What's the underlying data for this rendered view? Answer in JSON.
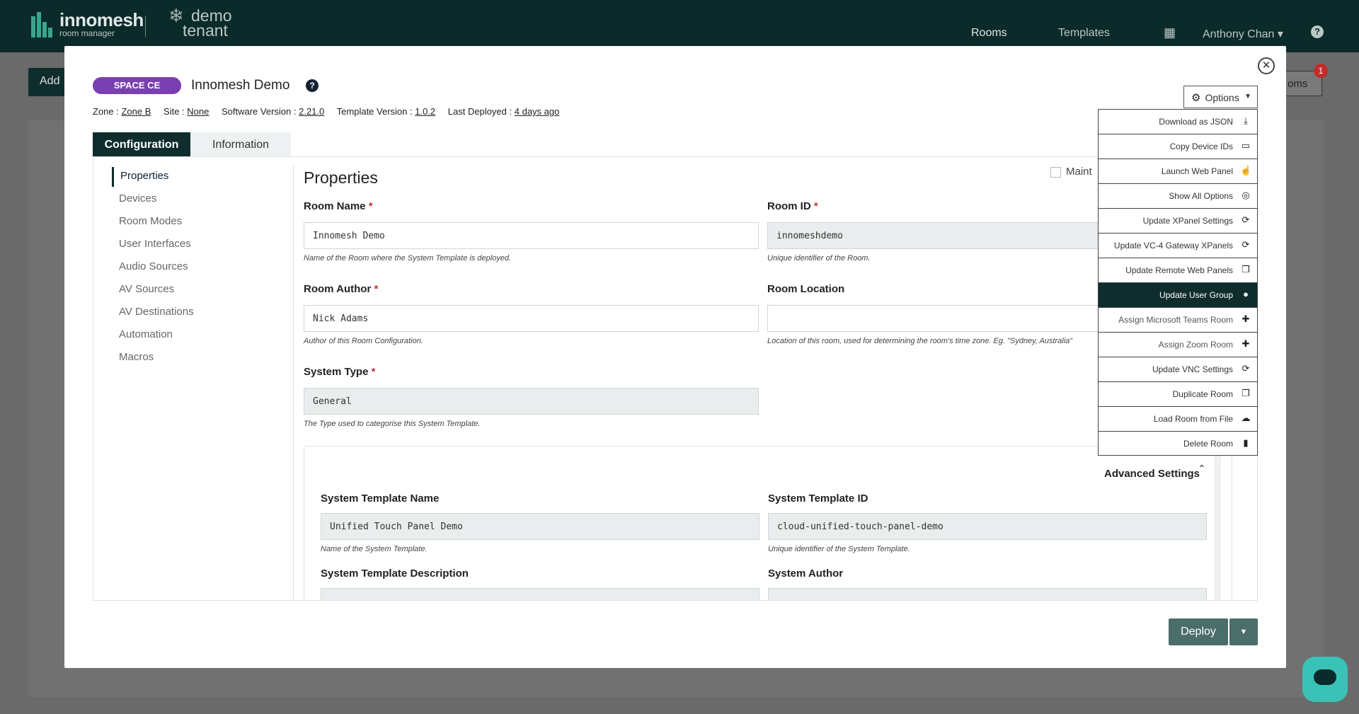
{
  "nav": {
    "brand": "innomesh",
    "brand_sub": "room manager",
    "tenant_line1": "demo",
    "tenant_line2": "tenant",
    "rooms": "Rooms",
    "templates": "Templates",
    "user": "Anthony Chan",
    "help_icon": "question-circle-icon"
  },
  "background": {
    "add_label": "Add",
    "rooms_label": "oms",
    "badge": "1"
  },
  "modal": {
    "badge": "SPACE CE",
    "title": "Innomesh Demo",
    "meta": {
      "zone_label": "Zone :",
      "zone": "Zone B",
      "site_label": "Site :",
      "site": "None",
      "software_label": "Software Version :",
      "software": "2.21.0",
      "template_label": "Template Version :",
      "template": "1.0.2",
      "deployed_label": "Last Deployed :",
      "deployed": "4 days ago"
    },
    "tabs": [
      "Configuration",
      "Information"
    ],
    "sidebar": [
      "Properties",
      "Devices",
      "Room Modes",
      "User Interfaces",
      "Audio Sources",
      "AV Sources",
      "AV Destinations",
      "Automation",
      "Macros"
    ],
    "heading": "Properties",
    "maintenance": "Maint",
    "fields": {
      "room_name": {
        "label": "Room Name",
        "value": "Innomesh Demo",
        "hint": "Name of the Room where the System Template is deployed."
      },
      "room_id": {
        "label": "Room ID",
        "value": "innomeshdemo",
        "hint": "Unique identifier of the Room."
      },
      "room_author": {
        "label": "Room Author",
        "value": "Nick Adams",
        "hint": "Author of this Room Configuration."
      },
      "room_location": {
        "label": "Room Location",
        "value": "",
        "hint": "Location of this room, used for determining the room's time zone. Eg. \"Sydney, Australia\""
      },
      "system_type": {
        "label": "System Type",
        "value": "General",
        "hint": "The Type used to categorise this System Template."
      }
    },
    "advanced": {
      "title": "Advanced Settings",
      "template_name": {
        "label": "System Template Name",
        "value": "Unified Touch Panel Demo",
        "hint": "Name of the System Template."
      },
      "template_id": {
        "label": "System Template ID",
        "value": "cloud-unified-touch-panel-demo",
        "hint": "Unique identifier of the System Template."
      },
      "template_desc": {
        "label": "System Template Description"
      },
      "author": {
        "label": "System Author"
      }
    },
    "deploy": "Deploy",
    "options": "Options",
    "menu": [
      {
        "label": "Download as JSON",
        "icon": "download-icon",
        "glyph": "⤓"
      },
      {
        "label": "Copy Device IDs",
        "icon": "monitor-icon",
        "glyph": "▭"
      },
      {
        "label": "Launch Web Panel",
        "icon": "pointer-icon",
        "glyph": "☝"
      },
      {
        "label": "Show All Options",
        "icon": "eye-slash-icon",
        "glyph": "◎"
      },
      {
        "label": "Update XPanel Settings",
        "icon": "sync-icon",
        "glyph": "⟳"
      },
      {
        "label": "Update VC-4 Gateway XPanels",
        "icon": "sync-icon",
        "glyph": "⟳"
      },
      {
        "label": "Update Remote Web Panels",
        "icon": "copy-icon",
        "glyph": "❐"
      },
      {
        "label": "Update User Group",
        "icon": "user-icon",
        "glyph": "●"
      },
      {
        "label": "Assign Microsoft Teams Room",
        "icon": "user-plus-icon",
        "glyph": "✚"
      },
      {
        "label": "Assign Zoom Room",
        "icon": "user-plus-icon",
        "glyph": "✚"
      },
      {
        "label": "Update VNC Settings",
        "icon": "sync-icon",
        "glyph": "⟳"
      },
      {
        "label": "Duplicate Room",
        "icon": "clone-icon",
        "glyph": "❐"
      },
      {
        "label": "Load Room from File",
        "icon": "cloud-upload-icon",
        "glyph": "☁"
      },
      {
        "label": "Delete Room",
        "icon": "trash-icon",
        "glyph": "▮"
      }
    ]
  }
}
